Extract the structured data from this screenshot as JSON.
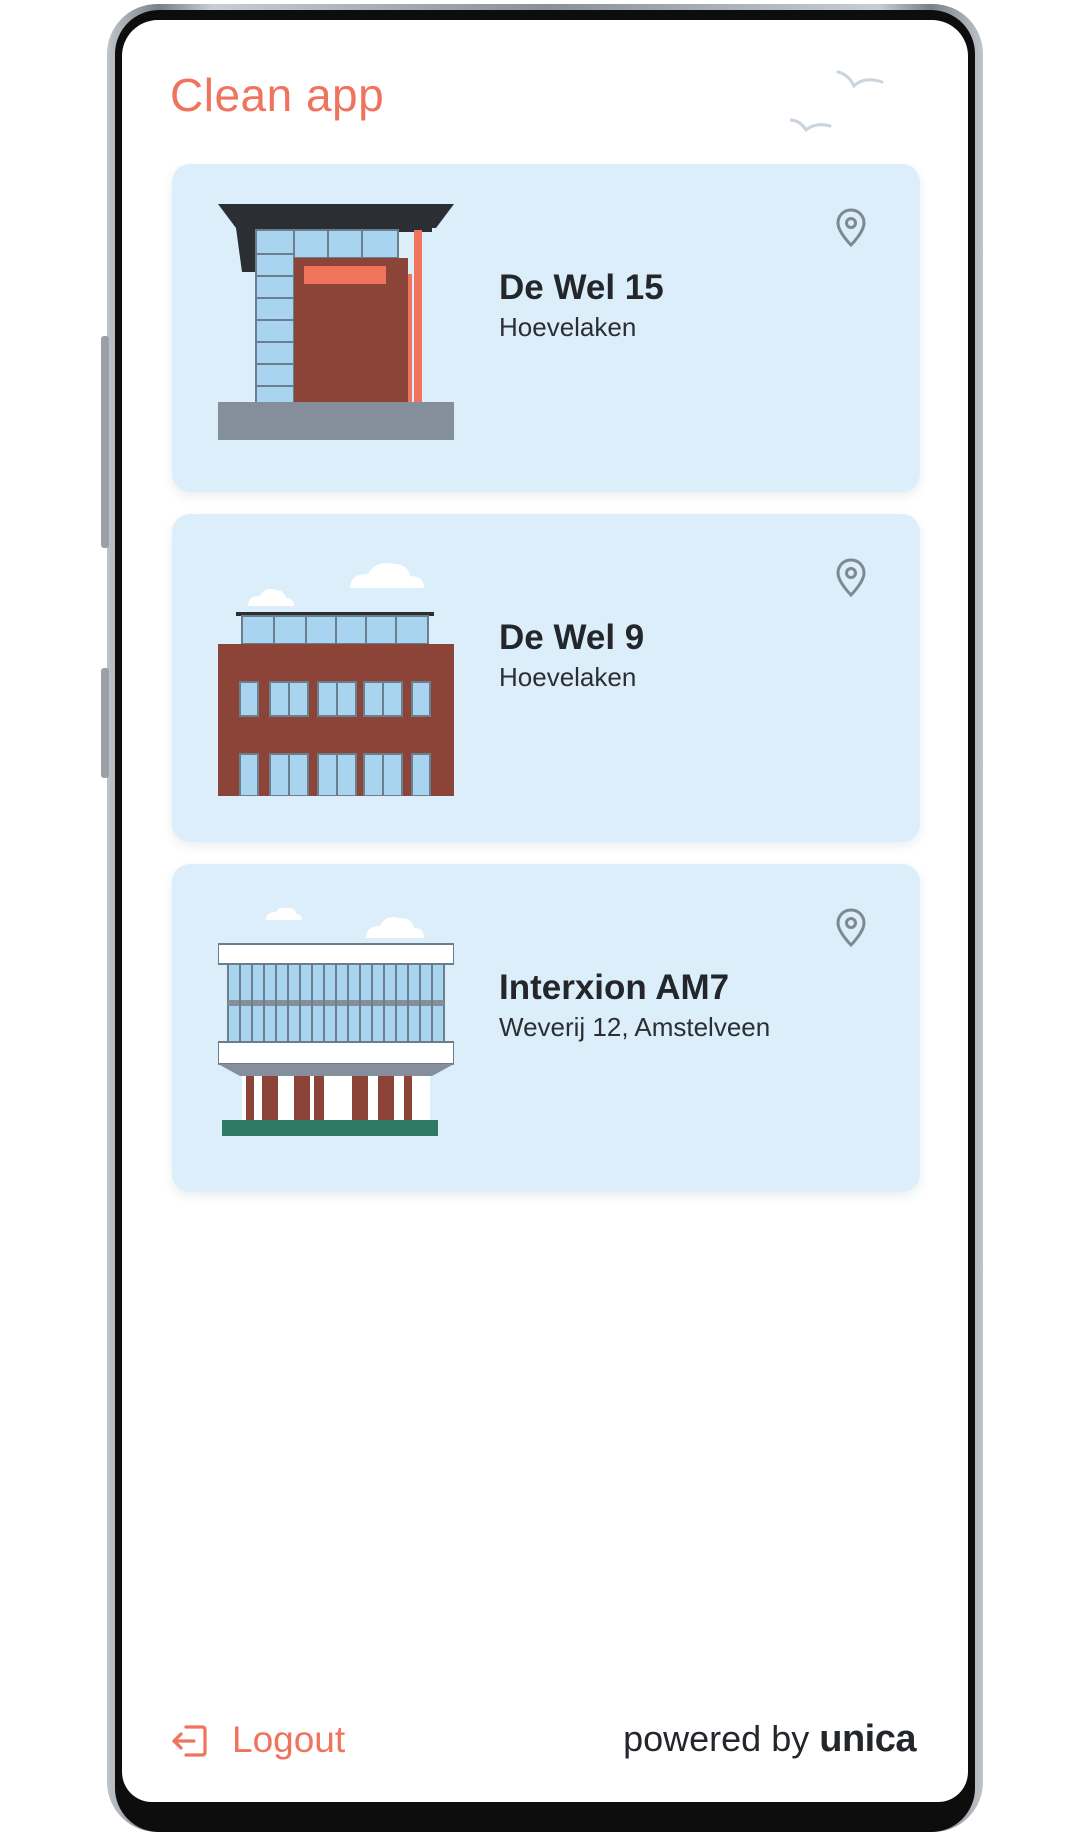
{
  "app": {
    "title": "Clean app"
  },
  "locations": [
    {
      "name": "De Wel 15",
      "address": "Hoevelaken"
    },
    {
      "name": "De Wel 9",
      "address": "Hoevelaken"
    },
    {
      "name": "Interxion AM7",
      "address": "Weverij 12, Amstelveen"
    }
  ],
  "footer": {
    "logout_label": "Logout",
    "powered_prefix": "powered by",
    "brand": "unica"
  },
  "colors": {
    "accent": "#f0735e",
    "card_background": "#ddeefb",
    "text_dark": "#23272b",
    "brick": "#8b4437",
    "window_blue": "#a9d4f0",
    "pin_gray": "#7d8a96"
  },
  "icons": {
    "location": "map-pin-icon",
    "logout": "logout-icon",
    "decoration": "birds-illustration"
  }
}
